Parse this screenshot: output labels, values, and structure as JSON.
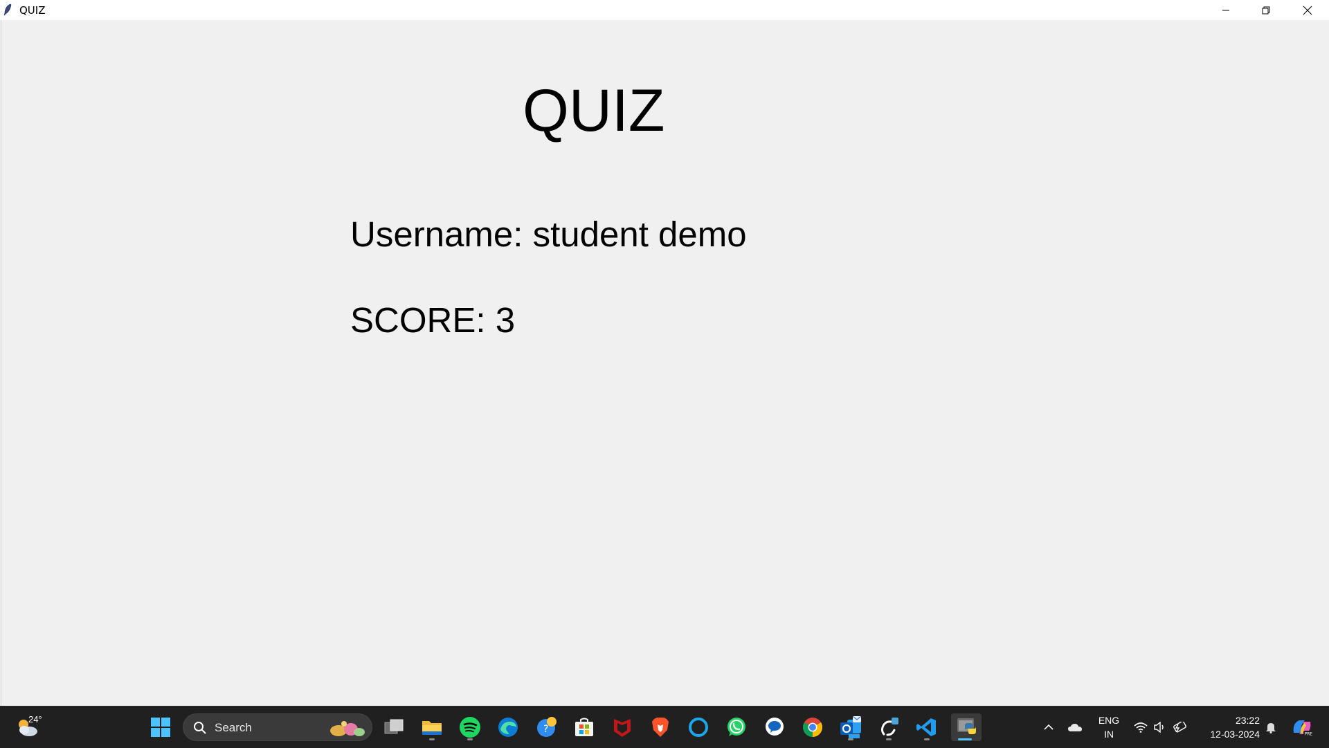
{
  "window": {
    "title": "QUIZ"
  },
  "content": {
    "heading": "QUIZ",
    "username_line": "Username: student demo",
    "score_line": "SCORE: 3"
  },
  "taskbar": {
    "weather_temp": "24°",
    "search_label": "Search",
    "pinned_apps": [
      "start-button",
      "task-view",
      "file-explorer",
      "spotify",
      "edge",
      "microsoft-edge-dev",
      "microsoft-store",
      "mcafee",
      "brave",
      "cortana",
      "whatsapp",
      "messenger",
      "chrome",
      "outlook",
      "mobile-link",
      "vs-code",
      "python"
    ],
    "tray": {
      "language_line1": "ENG",
      "language_line2": "IN",
      "time": "23:22",
      "date": "12-03-2024"
    }
  },
  "colors": {
    "window_bg": "#f0f0f0",
    "titlebar_bg": "#ffffff",
    "taskbar_bg": "#202020",
    "active_indicator": "#4cc2ff"
  }
}
